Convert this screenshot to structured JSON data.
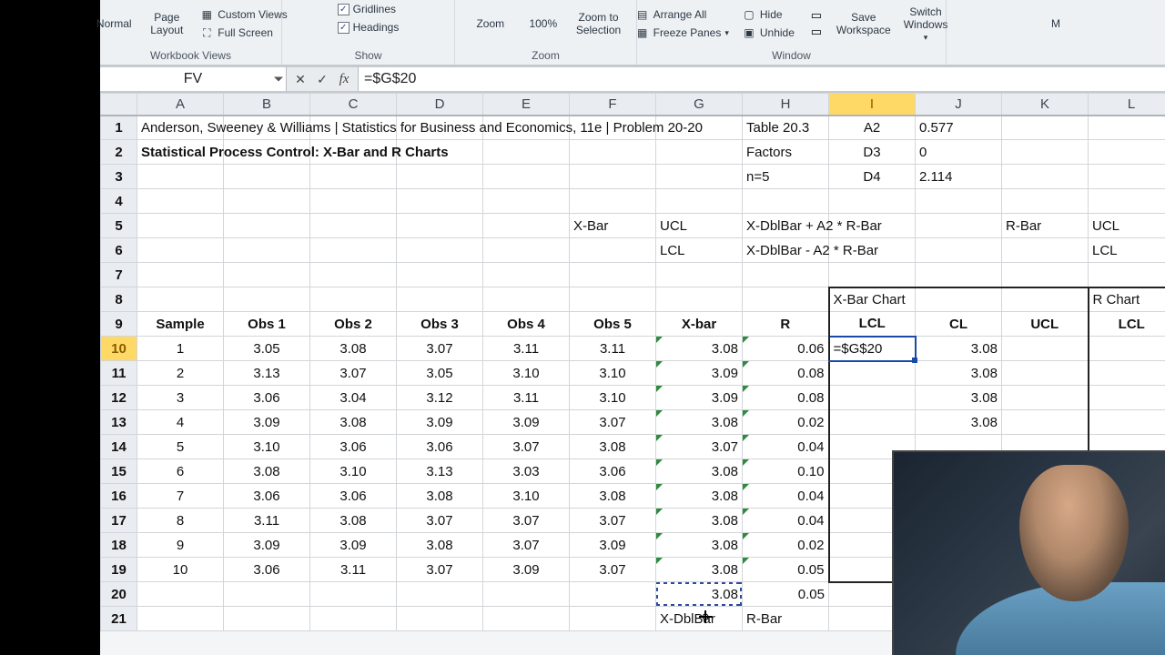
{
  "ribbon": {
    "groups": {
      "workbook_views": "Workbook Views",
      "show": "Show",
      "zoom": "Zoom",
      "window": "Window"
    },
    "normal": "Normal",
    "page_layout": "Page\nLayout",
    "custom_views": "Custom Views",
    "full_screen": "Full Screen",
    "gridlines": "Gridlines",
    "headings": "Headings",
    "zoom": "Zoom",
    "hundred": "100%",
    "zoom_selection": "Zoom to\nSelection",
    "arrange_all": "Arrange All",
    "freeze_panes": "Freeze Panes",
    "hide": "Hide",
    "unhide": "Unhide",
    "save_workspace": "Save\nWorkspace",
    "switch_windows": "Switch\nWindows",
    "macros_hint": "M"
  },
  "formula_bar": {
    "name_box": "FV",
    "formula": "=$G$20"
  },
  "columns": [
    "A",
    "B",
    "C",
    "D",
    "E",
    "F",
    "G",
    "H",
    "I",
    "J",
    "K",
    "L"
  ],
  "rows_labels": [
    "1",
    "2",
    "3",
    "4",
    "5",
    "6",
    "7",
    "8",
    "9",
    "10",
    "11",
    "12",
    "13",
    "14",
    "15",
    "16",
    "17",
    "18",
    "19",
    "20",
    "21"
  ],
  "active_col": "I",
  "active_row": "10",
  "cells": {
    "r1": {
      "a": "Anderson, Sweeney & Williams | Statistics for Business and Economics, 11e | Problem 20-20",
      "h": "Table 20.3",
      "i": "A2",
      "j": "0.577"
    },
    "r2": {
      "a": "Statistical Process Control:  X-Bar and R Charts",
      "h": "Factors",
      "i": "D3",
      "j": "0"
    },
    "r3": {
      "h": "n=5",
      "i": "D4",
      "j": "2.114"
    },
    "r5": {
      "f": "X-Bar",
      "g": "UCL",
      "h": "X-DblBar + A2 * R-Bar",
      "k": "R-Bar",
      "l": "UCL"
    },
    "r6": {
      "g": "LCL",
      "h": "X-DblBar - A2 * R-Bar",
      "l": "LCL"
    },
    "r8": {
      "i": "X-Bar Chart",
      "l": "R Chart"
    },
    "r9": {
      "a": "Sample",
      "b": "Obs 1",
      "c": "Obs 2",
      "d": "Obs 3",
      "e": "Obs 4",
      "f": "Obs 5",
      "g": "X-bar",
      "h": "R",
      "i": "LCL",
      "j": "CL",
      "k": "UCL",
      "l": "LCL"
    },
    "data_rows": [
      {
        "n": "1",
        "b": "3.05",
        "c": "3.08",
        "d": "3.07",
        "e": "3.11",
        "f": "3.11",
        "g": "3.08",
        "h": "0.06",
        "i": "=$G$20",
        "j": "3.08"
      },
      {
        "n": "2",
        "b": "3.13",
        "c": "3.07",
        "d": "3.05",
        "e": "3.10",
        "f": "3.10",
        "g": "3.09",
        "h": "0.08",
        "j": "3.08"
      },
      {
        "n": "3",
        "b": "3.06",
        "c": "3.04",
        "d": "3.12",
        "e": "3.11",
        "f": "3.10",
        "g": "3.09",
        "h": "0.08",
        "j": "3.08"
      },
      {
        "n": "4",
        "b": "3.09",
        "c": "3.08",
        "d": "3.09",
        "e": "3.09",
        "f": "3.07",
        "g": "3.08",
        "h": "0.02",
        "j": "3.08"
      },
      {
        "n": "5",
        "b": "3.10",
        "c": "3.06",
        "d": "3.06",
        "e": "3.07",
        "f": "3.08",
        "g": "3.07",
        "h": "0.04"
      },
      {
        "n": "6",
        "b": "3.08",
        "c": "3.10",
        "d": "3.13",
        "e": "3.03",
        "f": "3.06",
        "g": "3.08",
        "h": "0.10"
      },
      {
        "n": "7",
        "b": "3.06",
        "c": "3.06",
        "d": "3.08",
        "e": "3.10",
        "f": "3.08",
        "g": "3.08",
        "h": "0.04"
      },
      {
        "n": "8",
        "b": "3.11",
        "c": "3.08",
        "d": "3.07",
        "e": "3.07",
        "f": "3.07",
        "g": "3.08",
        "h": "0.04"
      },
      {
        "n": "9",
        "b": "3.09",
        "c": "3.09",
        "d": "3.08",
        "e": "3.07",
        "f": "3.09",
        "g": "3.08",
        "h": "0.02"
      },
      {
        "n": "10",
        "b": "3.06",
        "c": "3.11",
        "d": "3.07",
        "e": "3.09",
        "f": "3.07",
        "g": "3.08",
        "h": "0.05"
      }
    ],
    "r20": {
      "g": "3.08",
      "h": "0.05"
    },
    "r21": {
      "g": "X-DblBar",
      "h": "R-Bar"
    }
  }
}
